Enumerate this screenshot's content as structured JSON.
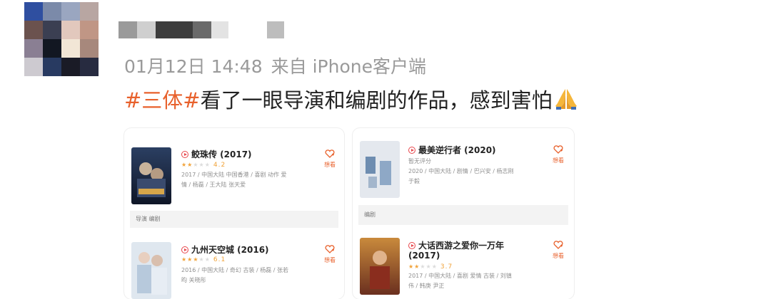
{
  "post": {
    "timestamp": "01月12日 14:48",
    "source": "来自 iPhone客户端",
    "hashtag": "#三体#",
    "text": "看了一眼导演和编剧的作品，感到害怕",
    "emoji": "pray-emoji"
  },
  "avatar": {
    "colors": [
      "#2f4fa0",
      "#7b8aa9",
      "#9aa6c0",
      "#b8a6a2",
      "#6b524e",
      "#3b3f52",
      "#e2c8bd",
      "#c09685",
      "#8a7f93",
      "#121722",
      "#f2e6d6",
      "#a7887c",
      "#cdcad0",
      "#283a61",
      "#1a1b26",
      "#272b40"
    ]
  },
  "username_blocks": [
    "#9a9a9a",
    "#cfcfcf",
    "#3d3d3d",
    "#6a6a6a",
    "#e3e3e3",
    "#ffffff",
    "#bdbdbd"
  ],
  "cards": [
    {
      "items": [
        {
          "title": "鲛珠传 (2017)",
          "rating": "4.2",
          "stars_on": 2,
          "desc_lines": [
            "2017 / 中国大陆 中国香港 / 喜剧 动作 爱",
            "情 / 杨磊 / 王大陆 张天爱"
          ],
          "want": "想看",
          "role": "导演 编剧"
        },
        {
          "title": "九州天空城 (2016)",
          "rating": "6.1",
          "stars_on": 3,
          "desc_lines": [
            "2016 / 中国大陆 / 奇幻 古装 / 杨磊 / 张若",
            "昀 关晓彤"
          ],
          "want": "想看"
        }
      ]
    },
    {
      "items": [
        {
          "title": "最美逆行者 (2020)",
          "rating": "暂无评分",
          "stars_on": 0,
          "desc_lines": [
            "2020 / 中国大陆 / 剧情 / 巴兴安 / 杨志刚",
            "于毅"
          ],
          "want": "想看",
          "role": "编剧"
        },
        {
          "title": "大话西游之爱你一万年",
          "title2": "(2017)",
          "rating": "3.7",
          "stars_on": 2,
          "desc_lines": [
            "2017 / 中国大陆 / 喜剧 爱情 古装 / 刘镇",
            "伟 / 韩庚 尹正"
          ],
          "want": "想看"
        }
      ]
    }
  ],
  "colors": {
    "accent": "#e8612c",
    "meta": "#9a9a9a",
    "star": "#f1a33a"
  }
}
